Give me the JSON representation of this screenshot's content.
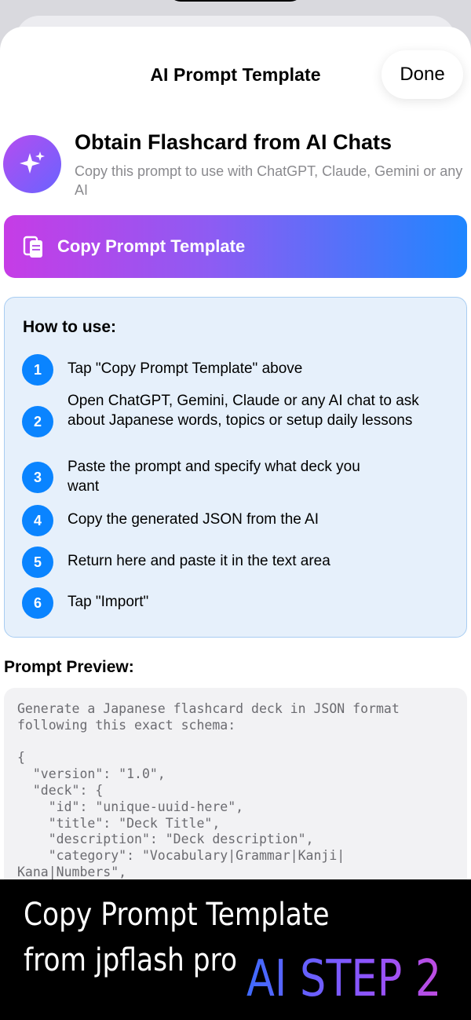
{
  "nav": {
    "title": "AI Prompt Template",
    "done_label": "Done"
  },
  "header": {
    "icon": "sparkles-icon",
    "title": "Obtain Flashcard from AI Chats",
    "subtitle": "Copy this prompt to use with ChatGPT, Claude, Gemini or any AI"
  },
  "copy_button": {
    "icon": "copy-document-icon",
    "label": "Copy Prompt Template"
  },
  "how_to": {
    "title": "How to use:",
    "steps": [
      {
        "number": "1",
        "text": "Tap \"Copy Prompt Template\" above"
      },
      {
        "number": "2",
        "text": "Open ChatGPT, Gemini, Claude or any AI chat to ask about Japanese words, topics or setup daily lessons"
      },
      {
        "number": "3",
        "text": "Paste the prompt and specify what deck you want"
      },
      {
        "number": "4",
        "text": "Copy the generated JSON from the AI"
      },
      {
        "number": "5",
        "text": "Return here and paste it in the text area"
      },
      {
        "number": "6",
        "text": "Tap \"Import\""
      }
    ]
  },
  "preview": {
    "title": "Prompt Preview:",
    "code": "Generate a Japanese flashcard deck in JSON format\nfollowing this exact schema:\n\n{\n  \"version\": \"1.0\",\n  \"deck\": {\n    \"id\": \"unique-uuid-here\",\n    \"title\": \"Deck Title\",\n    \"description\": \"Deck description\",\n    \"category\": \"Vocabulary|Grammar|Kanji|\nKana|Numbers\","
  },
  "overlay": {
    "line1": "Copy Prompt Template",
    "line2": "from jpflash pro",
    "step_label": "AI STEP 2"
  },
  "colors": {
    "accent_blue": "#0a84ff",
    "gradient_start": "#c63ce6",
    "gradient_end": "#1f86ff",
    "howto_bg": "#e6f0fb"
  }
}
